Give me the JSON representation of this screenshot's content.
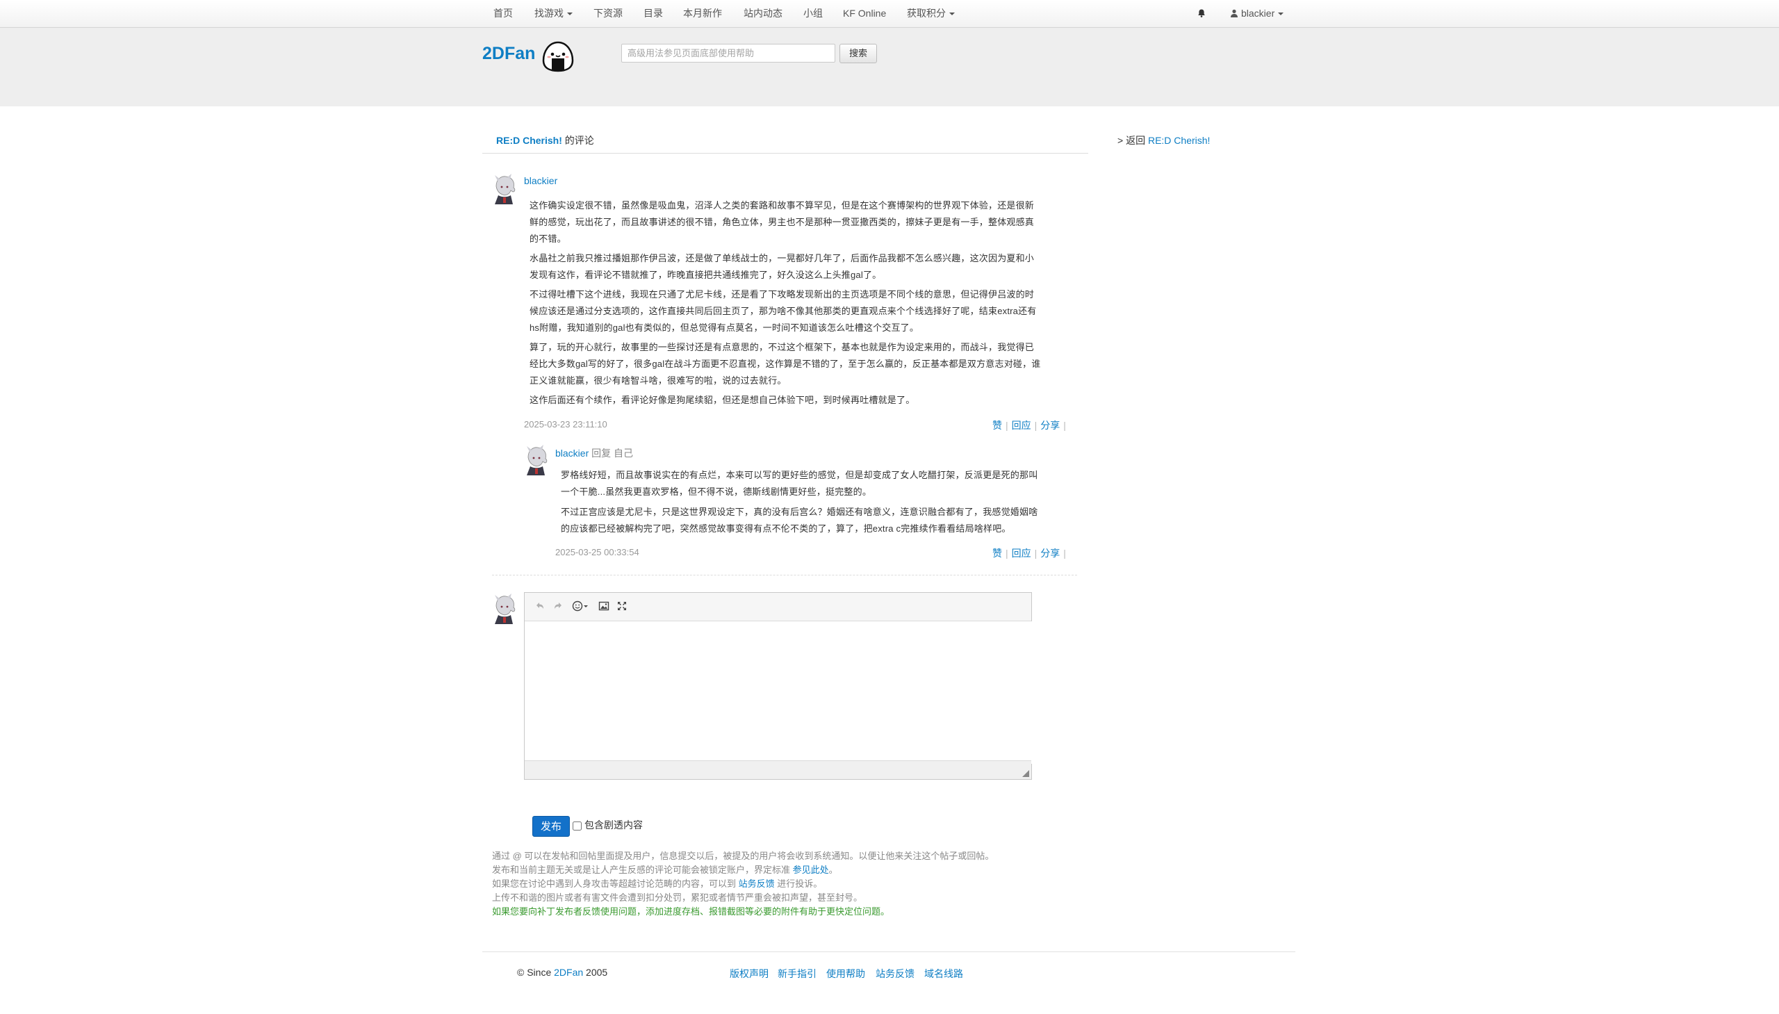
{
  "nav": {
    "items": [
      {
        "label": "首页",
        "dropdown": false
      },
      {
        "label": "找游戏",
        "dropdown": true
      },
      {
        "label": "下资源",
        "dropdown": false
      },
      {
        "label": "目录",
        "dropdown": false
      },
      {
        "label": "本月新作",
        "dropdown": false
      },
      {
        "label": "站内动态",
        "dropdown": false
      },
      {
        "label": "小组",
        "dropdown": false
      },
      {
        "label": "KF Online",
        "dropdown": false
      },
      {
        "label": "获取积分",
        "dropdown": true
      }
    ],
    "bell_icon": "bell-icon",
    "user": "blackier"
  },
  "header": {
    "logo": "2DFan",
    "search_placeholder": "高级用法参见页面底部使用帮助",
    "search_button": "搜索"
  },
  "crumb": {
    "game": "RE:D Cherish!",
    "suffix": " 的评论",
    "back_prefix": "> 返回 ",
    "back_link": "RE:D Cherish!"
  },
  "comment": {
    "author": "blackier",
    "paragraphs": [
      [
        "这作确实设定很不错，虽然像是吸血鬼，沼泽人之类的套路和故事不算罕见，但是在这个赛博架构的世界观下体验，还是很新",
        "鲜的感觉，玩出花了，而且故事讲述的很不错，角色立体，男主也不是那种一贯亚撒西类的，擦妹子更是有一手，整体观感真",
        "的不错。"
      ],
      [
        "水晶社之前我只推过播姐那作伊吕波，还是做了单线战士的，一晃都好几年了，后面作品我都不怎么感兴趣，这次因为夏和小",
        "发现有这作，看评论不错就推了，昨晚直接把共通线推完了，好久没这么上头推gal了。"
      ],
      [
        "不过得吐槽下这个进线，我现在只通了尤尼卡线，还是看了下攻略发现新出的主页选项是不同个线的意思，但记得伊吕波的时",
        "候应该还是通过分支选项的，这作直接共同后回主页了，那为啥不像其他那类的更直观点来个个线选择好了呢，结束extra还有",
        "hs附赠，我知道别的gal也有类似的，但总觉得有点莫名，一时间不知道该怎么吐槽这个交互了。"
      ],
      [
        "算了，玩的开心就行，故事里的一些探讨还是有点意思的，不过这个框架下，基本也就是作为设定来用的，而战斗，我觉得已",
        "经比大多数gal写的好了，很多gal在战斗方面更不忍直视，这作算是不错的了，至于怎么赢的，反正基本都是双方意志对碰，谁",
        "正义谁就能赢，很少有啥智斗啥，很难写的啦，说的过去就行。"
      ],
      [
        "这作后面还有个续作，看评论好像是狗尾续貂，但还是想自己体验下吧，到时候再吐槽就是了。"
      ]
    ],
    "timestamp": "2025-03-23 23:11:10",
    "actions": [
      "赞",
      "回应",
      "分享"
    ]
  },
  "reply": {
    "author": "blackier",
    "reply_word": " 回复 ",
    "target": "自己",
    "paragraphs": [
      [
        "罗格线好短，而且故事说实在的有点烂，本来可以写的更好些的感觉，但是却变成了女人吃醋打架，反派更是死的那叫",
        "一个干脆...虽然我更喜欢罗格，但不得不说，德斯线剧情更好些，挺完整的。"
      ],
      [
        "不过正宫应该是尤尼卡，只是这世界观设定下，真的没有后宫么？婚姻还有啥意义，连意识融合都有了，我感觉婚姻啥",
        "的应该都已经被解构完了吧，突然感觉故事变得有点不伦不类的了，算了，把extra c完推续作看看结局啥样吧。"
      ]
    ],
    "timestamp": "2025-03-25 00:33:54",
    "actions": [
      "赞",
      "回应",
      "分享"
    ]
  },
  "editor": {
    "tools": [
      "undo-icon",
      "redo-icon",
      "emoji-icon",
      "image-icon",
      "fullscreen-icon"
    ],
    "publish": "发布",
    "spoiler_label": "包含剧透内容"
  },
  "notes": {
    "line1": "通过 @ 可以在发帖和回帖里面提及用户，信息提交以后，被提及的用户将会收到系统通知。以便让他来关注这个帖子或回帖。",
    "line2_a": "发布和当前主题无关或是让人产生反感的评论可能会被锁定账户，界定标准 ",
    "line2_link": "参见此处",
    "line2_b": "。",
    "line3_a": "如果您在讨论中遇到人身攻击等超越讨论范畴的内容，可以到 ",
    "line3_link": "站务反馈",
    "line3_b": " 进行投诉。",
    "line4": "上传不和谐的图片或者有害文件会遭到扣分处罚，累犯或者情节严重会被扣声望，甚至封号。",
    "line5": "如果您要向补丁发布者反馈使用问题，添加进度存档、报错截图等必要的附件有助于更快定位问题。"
  },
  "footer": {
    "since": "© Since ",
    "site": "2DFan",
    "year": " 2005",
    "links": [
      "版权声明",
      "新手指引",
      "使用帮助",
      "站务反馈",
      "域名线路"
    ]
  },
  "colors": {
    "link": "#0e7ec4",
    "publish": "#1371c9",
    "green_note": "#3a9a2f",
    "header_band": "#eeeeee"
  }
}
